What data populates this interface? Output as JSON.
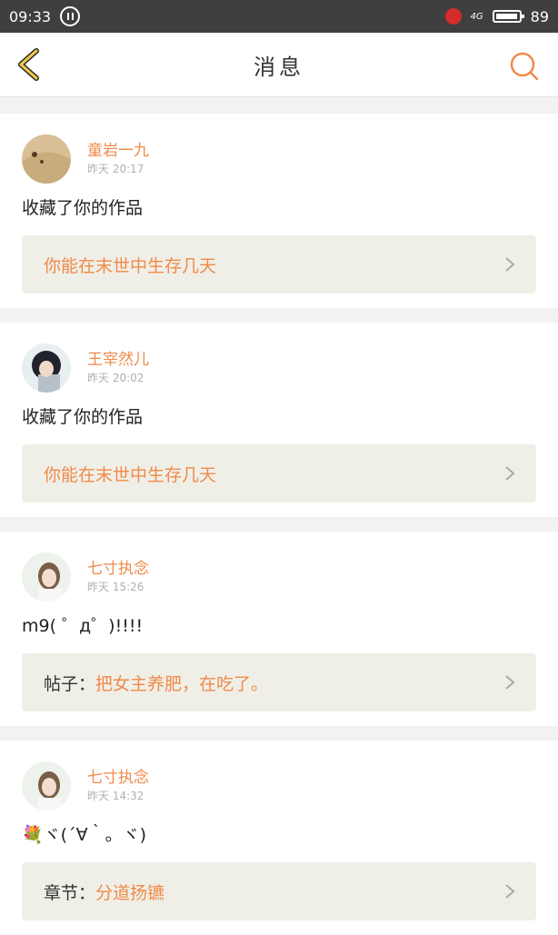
{
  "status_bar": {
    "time": "09:33",
    "network": "4G",
    "battery": "89"
  },
  "header": {
    "title": "消息"
  },
  "messages": [
    {
      "user": "童岩一九",
      "time": "昨天 20:17",
      "text": "收藏了你的作品",
      "ref_prefix": "",
      "ref_title": "你能在末世中生存几天"
    },
    {
      "user": "王宰然儿",
      "time": "昨天 20:02",
      "text": "收藏了你的作品",
      "ref_prefix": "",
      "ref_title": "你能在末世中生存几天"
    },
    {
      "user": "七寸执念",
      "time": "昨天 15:26",
      "text": "m9( ゜д゜)!!!!",
      "ref_prefix": "帖子：",
      "ref_title": "把女主养肥，在吃了。"
    },
    {
      "user": "七寸执念",
      "time": "昨天 14:32",
      "text": "💐ヾ(´∀｀。ヾ)",
      "ref_prefix": "章节：",
      "ref_title": "分道扬镳"
    }
  ]
}
